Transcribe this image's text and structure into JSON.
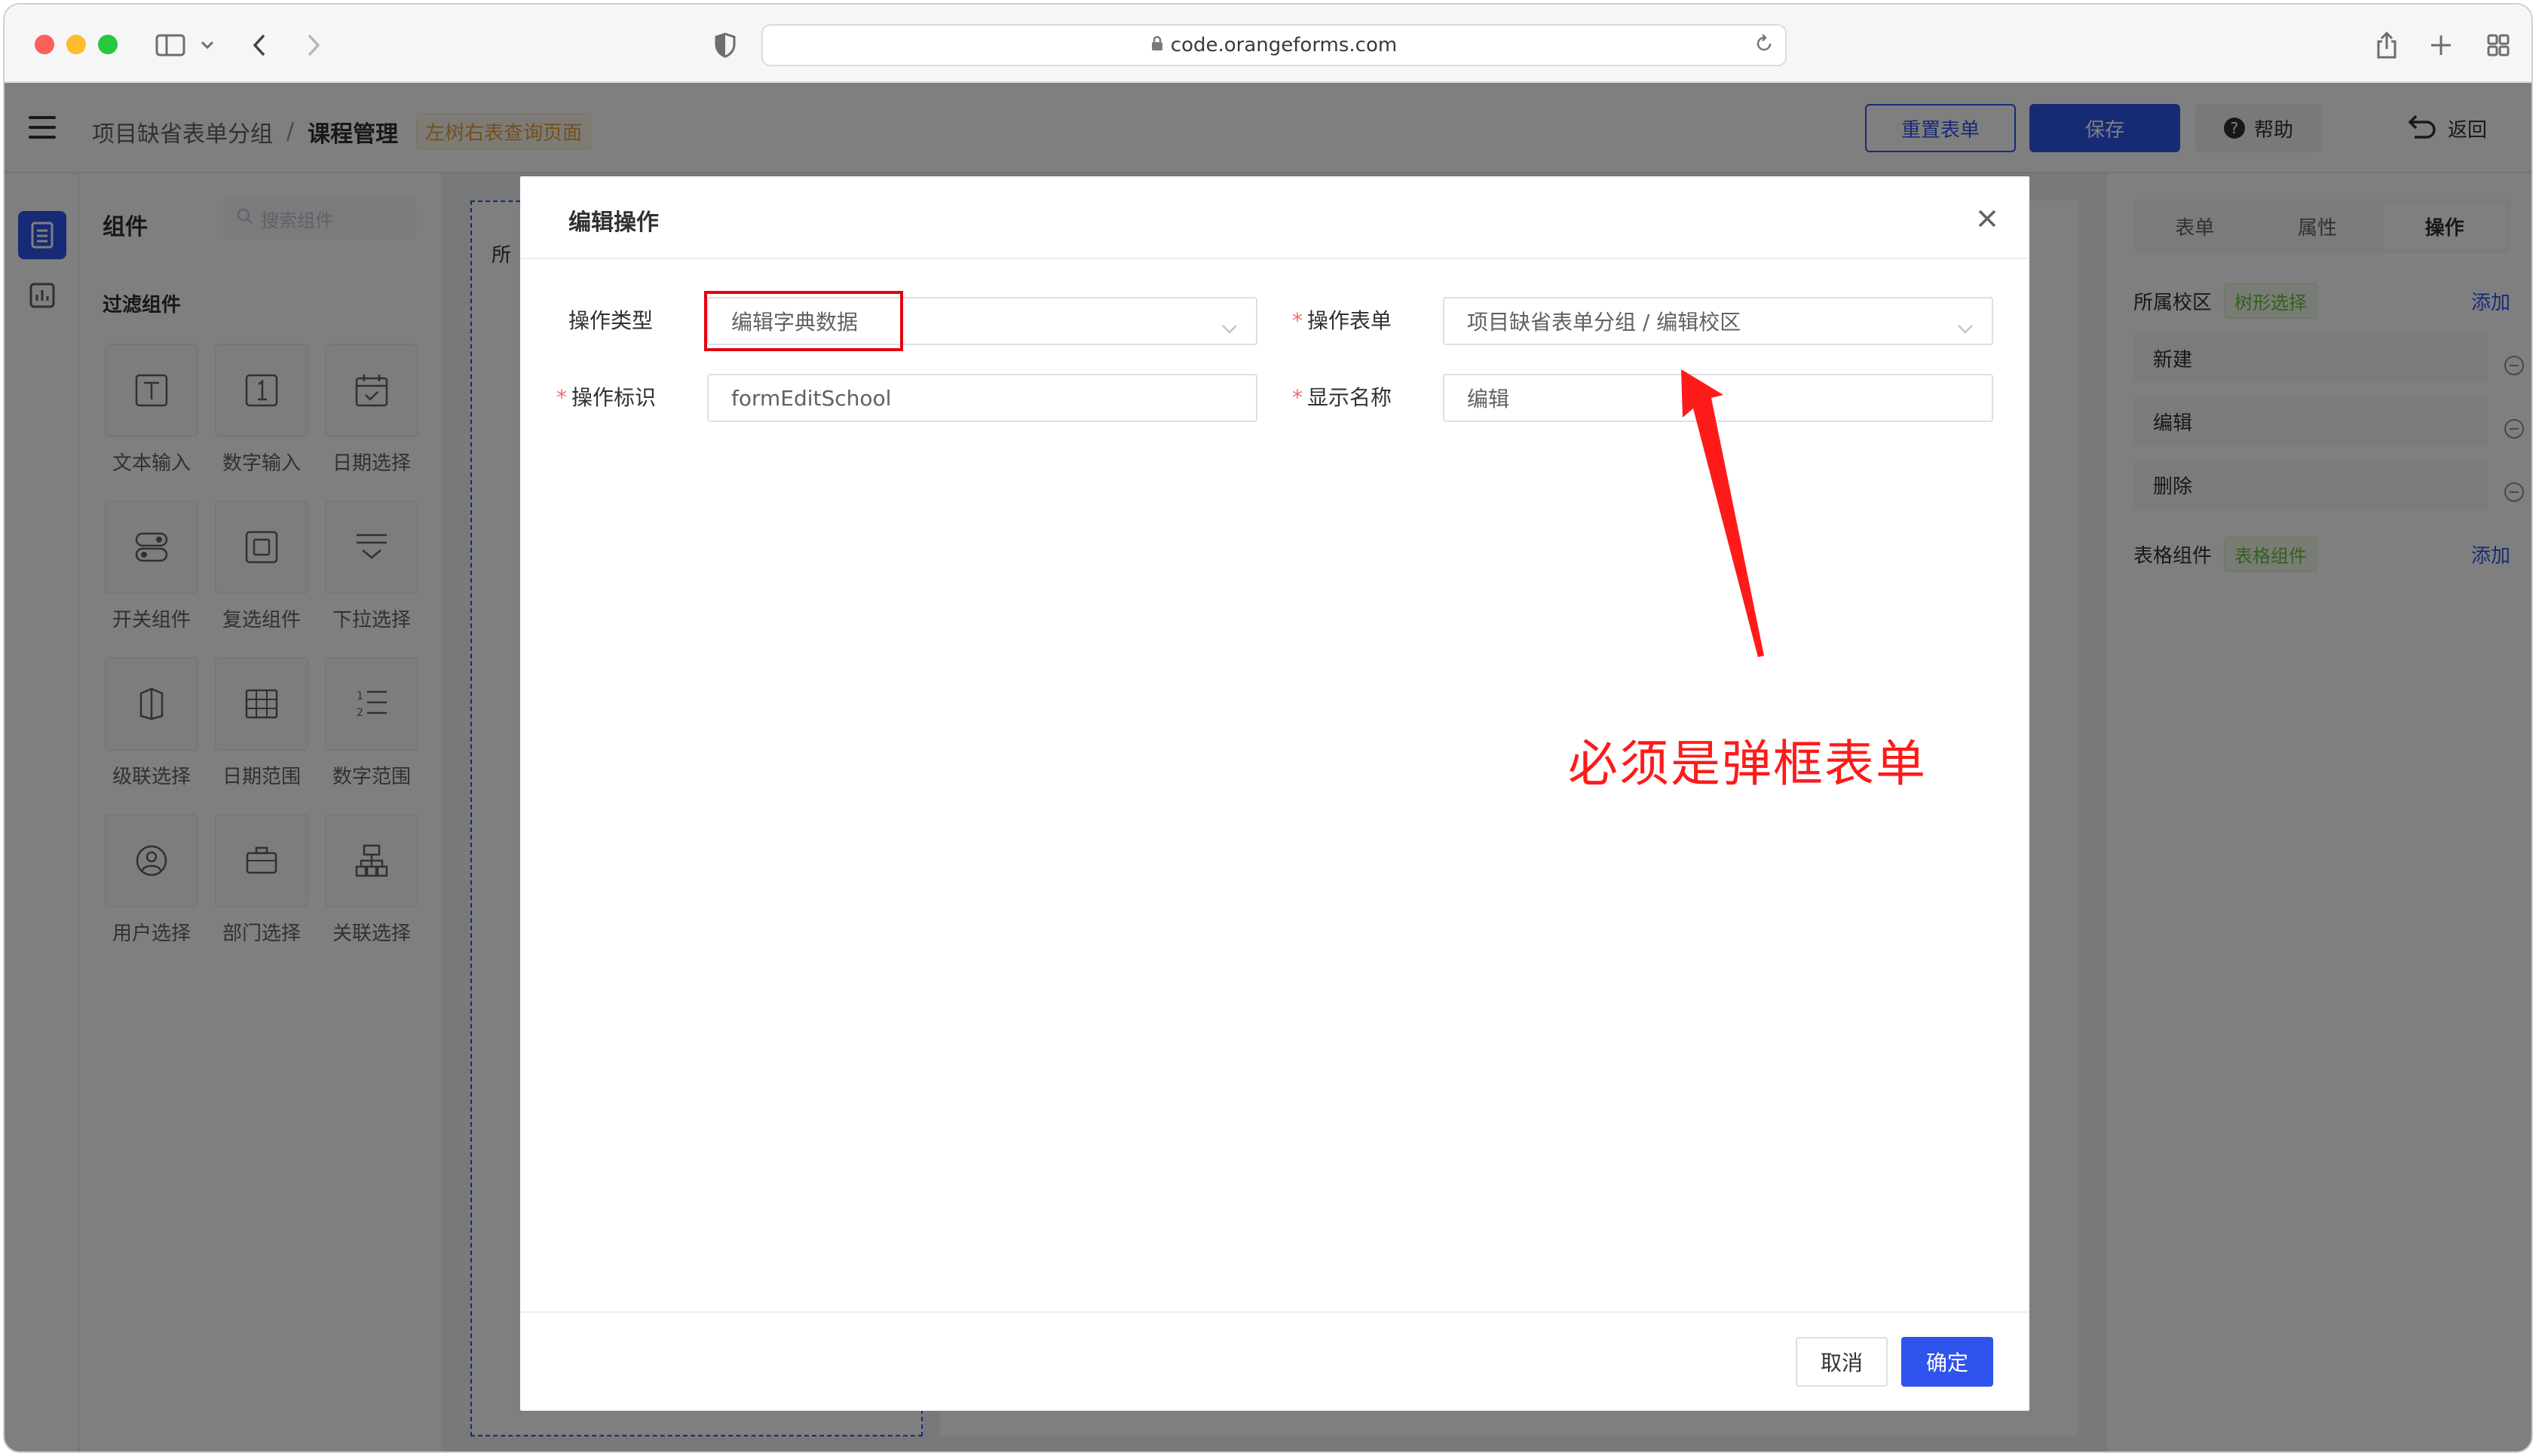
{
  "browser": {
    "url": "code.orangeforms.com"
  },
  "header": {
    "breadcrumb_root": "项目缺省表单分组",
    "breadcrumb_separator": "/",
    "breadcrumb_current": "课程管理",
    "page_tag": "左树右表查询页面",
    "reset_button": "重置表单",
    "save_button": "保存",
    "help_button": "帮助",
    "back_button": "返回"
  },
  "components_panel": {
    "title": "组件",
    "search_placeholder": "搜索组件",
    "group_title": "过滤组件",
    "items": [
      {
        "label": "文本输入",
        "icon": "text-input-icon"
      },
      {
        "label": "数字输入",
        "icon": "number-input-icon"
      },
      {
        "label": "日期选择",
        "icon": "date-picker-icon"
      },
      {
        "label": "开关组件",
        "icon": "switch-icon"
      },
      {
        "label": "复选组件",
        "icon": "checkbox-icon"
      },
      {
        "label": "下拉选择",
        "icon": "dropdown-icon"
      },
      {
        "label": "级联选择",
        "icon": "cascader-icon"
      },
      {
        "label": "日期范围",
        "icon": "date-range-icon"
      },
      {
        "label": "数字范围",
        "icon": "number-range-icon"
      },
      {
        "label": "用户选择",
        "icon": "user-select-icon"
      },
      {
        "label": "部门选择",
        "icon": "department-select-icon"
      },
      {
        "label": "关联选择",
        "icon": "relation-select-icon"
      }
    ]
  },
  "canvas": {
    "partial_label": "所"
  },
  "right_panel": {
    "tabs": [
      "表单",
      "属性",
      "操作"
    ],
    "active_tab": "操作",
    "section1_label": "所属校区",
    "section1_badge": "树形选择",
    "section1_add": "添加",
    "operations": [
      "新建",
      "编辑",
      "删除"
    ],
    "section2_label": "表格组件",
    "section2_badge": "表格组件",
    "section2_add": "添加"
  },
  "dialog": {
    "title": "编辑操作",
    "fields": {
      "op_type_label": "操作类型",
      "op_type_value": "编辑字典数据",
      "op_form_label": "操作表单",
      "op_form_value": "项目缺省表单分组 / 编辑校区",
      "op_id_label": "操作标识",
      "op_id_value": "formEditSchool",
      "display_name_label": "显示名称",
      "display_name_value": "编辑"
    },
    "cancel_button": "取消",
    "ok_button": "确定"
  },
  "annotation": {
    "text": "必须是弹框表单",
    "color": "#ff1a1a"
  },
  "colors": {
    "primary": "#2f54eb",
    "required": "#f56c6c",
    "highlight": "#e60012"
  }
}
